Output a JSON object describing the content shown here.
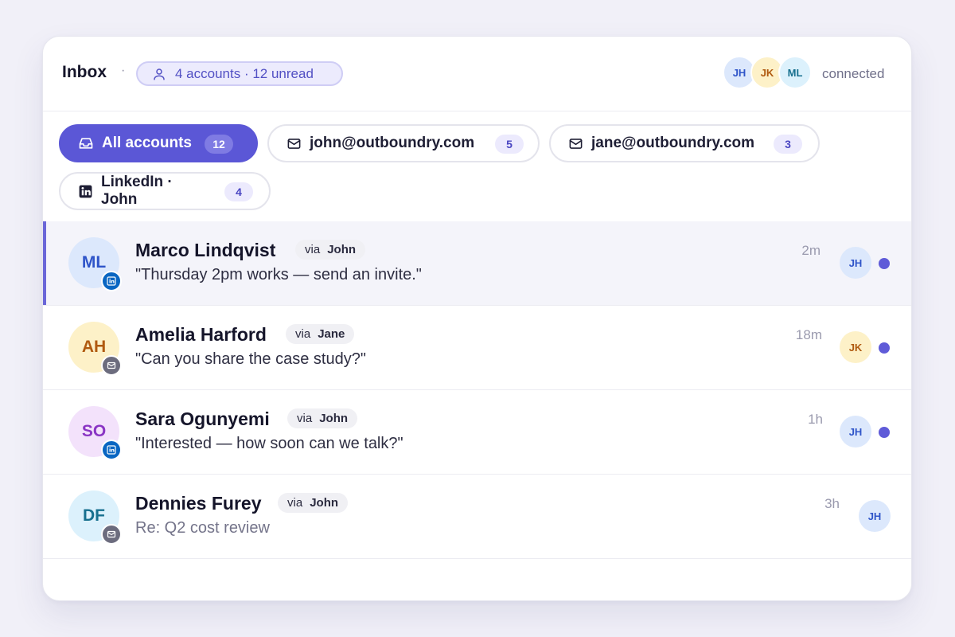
{
  "header": {
    "title": "Inbox",
    "separator": "·",
    "summary": "4 accounts · 12 unread",
    "connected_label": "connected",
    "connected_avatars": [
      {
        "initials": "JH",
        "bg": "#dce8fc",
        "fg": "#2f55c9"
      },
      {
        "initials": "JK",
        "bg": "#fdf1c8",
        "fg": "#b05a10"
      },
      {
        "initials": "ML",
        "bg": "#dcf1fc",
        "fg": "#17708f"
      }
    ]
  },
  "tabs": [
    {
      "label": "All accounts",
      "count": "12",
      "icon": "inbox-tray-icon",
      "active": true
    },
    {
      "label": "john@outboundry.com",
      "count": "5",
      "icon": "mail-icon",
      "active": false
    },
    {
      "label": "jane@outboundry.com",
      "count": "3",
      "icon": "mail-icon",
      "active": false
    },
    {
      "label": "LinkedIn · John",
      "count": "4",
      "icon": "linkedin-icon",
      "active": false
    }
  ],
  "threads": [
    {
      "initials": "ML",
      "avatar_bg": "#dce8fc",
      "avatar_fg": "#2f55c9",
      "channel": "linkedin-icon",
      "name": "Marco Lindqvist",
      "via_word": "via",
      "via_name": "John",
      "preview": "\"Thursday 2pm works — send an invite.\"",
      "time": "2m",
      "owner": "JH",
      "owner_bg": "#dce8fc",
      "owner_fg": "#2f55c9",
      "unread": true,
      "selected": true
    },
    {
      "initials": "AH",
      "avatar_bg": "#fdf1c8",
      "avatar_fg": "#b05a10",
      "channel": "mail-icon",
      "name": "Amelia Harford",
      "via_word": "via",
      "via_name": "Jane",
      "preview": "\"Can you share the case study?\"",
      "time": "18m",
      "owner": "JK",
      "owner_bg": "#fdf1c8",
      "owner_fg": "#b05a10",
      "unread": true,
      "selected": false
    },
    {
      "initials": "SO",
      "avatar_bg": "#f3e2fb",
      "avatar_fg": "#8a35c4",
      "channel": "linkedin-icon",
      "name": "Sara Ogunyemi",
      "via_word": "via",
      "via_name": "John",
      "preview": "\"Interested — how soon can we talk?\"",
      "time": "1h",
      "owner": "JH",
      "owner_bg": "#dce8fc",
      "owner_fg": "#2f55c9",
      "unread": true,
      "selected": false
    },
    {
      "initials": "DF",
      "avatar_bg": "#dcf1fc",
      "avatar_fg": "#17708f",
      "channel": "mail-icon",
      "name": "Dennies Furey",
      "via_word": "via",
      "via_name": "John",
      "preview": "Re: Q2 cost review",
      "time": "3h",
      "owner": "JH",
      "owner_bg": "#dce8fc",
      "owner_fg": "#2f55c9",
      "unread": false,
      "selected": false
    }
  ],
  "colors": {
    "accent": "#5b57d6",
    "unread_dot": "#5f5bd8",
    "linkedin": "#0a66c2"
  }
}
